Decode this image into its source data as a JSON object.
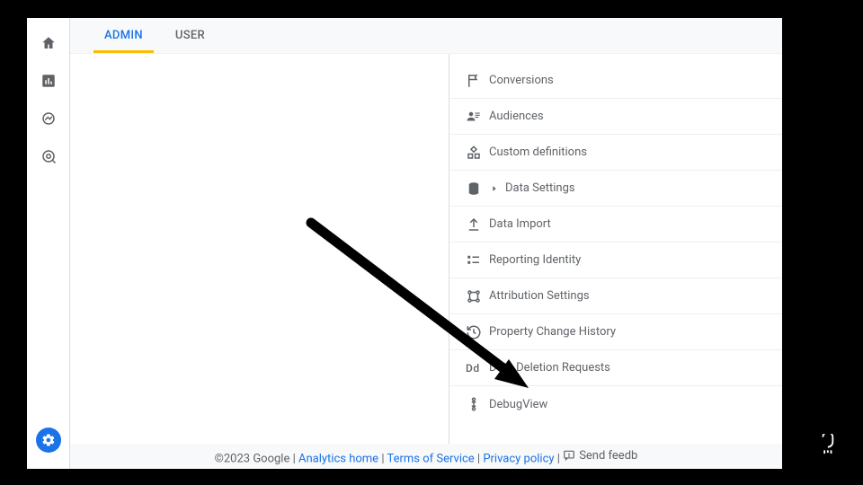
{
  "tabs": {
    "admin": "ADMIN",
    "user": "USER"
  },
  "menu": {
    "conversions": "Conversions",
    "audiences": "Audiences",
    "custom_definitions": "Custom definitions",
    "data_settings": "Data Settings",
    "data_import": "Data Import",
    "reporting_identity": "Reporting Identity",
    "attribution_settings": "Attribution Settings",
    "property_change_history": "Property Change History",
    "data_deletion_requests": "Data Deletion Requests",
    "debugview": "DebugView",
    "dd_icon_text": "Dd"
  },
  "footer": {
    "copyright": "©2023 Google",
    "analytics_home": "Analytics home",
    "terms": "Terms of Service",
    "privacy": "Privacy policy",
    "send_feedback": "Send feedb"
  }
}
